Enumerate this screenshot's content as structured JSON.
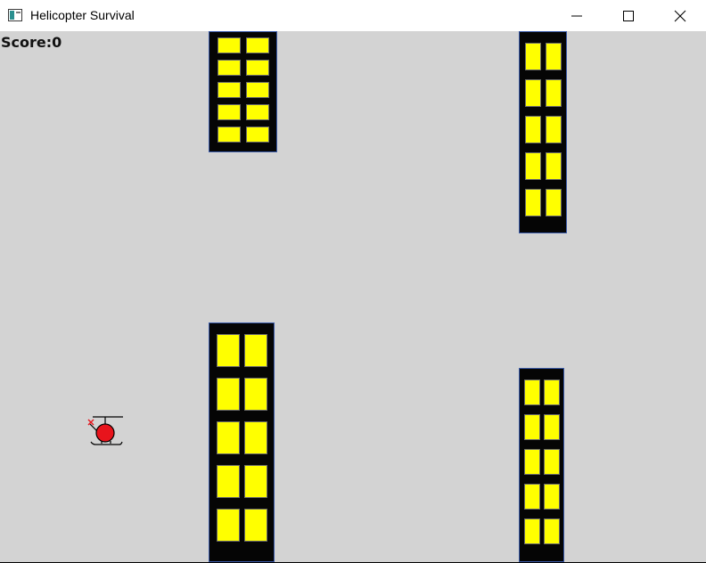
{
  "window": {
    "title": "Helicopter Survival",
    "icon": "app-window-icon",
    "controls": [
      "minimize-icon",
      "maximize-icon",
      "close-icon"
    ]
  },
  "hud": {
    "score_label": "Score:",
    "score_value": "0"
  },
  "colors": {
    "sky": "#d3d3d3",
    "building": "#050505",
    "building_outline": "#3a5aa8",
    "window_light": "#ffff00",
    "helicopter_body": "#e8141c"
  }
}
